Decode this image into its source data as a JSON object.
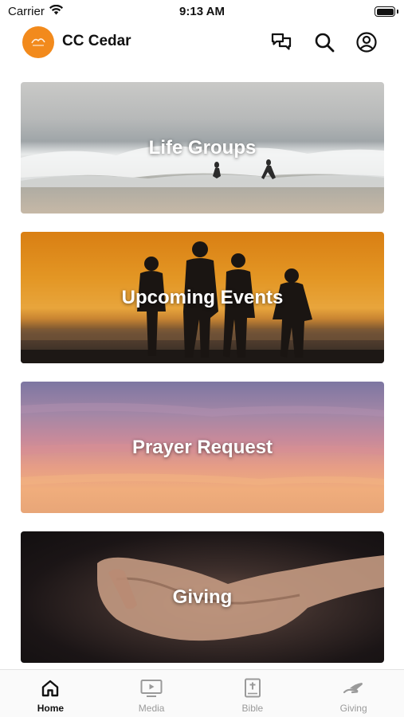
{
  "status_bar": {
    "carrier": "Carrier",
    "time": "9:13 AM"
  },
  "header": {
    "title": "CC Cedar",
    "logo_color": "#f28a1c",
    "icons": [
      "chat-icon",
      "search-icon",
      "profile-icon"
    ]
  },
  "cards": [
    {
      "label": "Life Groups"
    },
    {
      "label": "Upcoming Events"
    },
    {
      "label": "Prayer Request"
    },
    {
      "label": "Giving"
    }
  ],
  "tab_bar": {
    "tabs": [
      {
        "label": "Home",
        "icon": "home-icon",
        "active": true
      },
      {
        "label": "Media",
        "icon": "media-icon",
        "active": false
      },
      {
        "label": "Bible",
        "icon": "bible-icon",
        "active": false
      },
      {
        "label": "Giving",
        "icon": "giving-icon",
        "active": false
      }
    ],
    "active_color": "#111111",
    "inactive_color": "#9a9a9a"
  }
}
